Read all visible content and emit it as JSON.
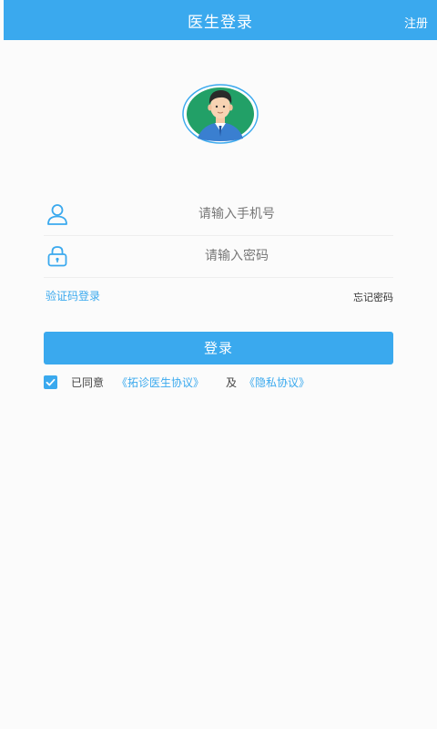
{
  "header": {
    "title": "医生登录",
    "register_label": "注册"
  },
  "avatar": {
    "icon": "doctor-avatar-icon"
  },
  "form": {
    "phone_placeholder": "请输入手机号",
    "phone_value": "",
    "phone_icon": "user-icon",
    "password_placeholder": "请输入密码",
    "password_value": "",
    "password_icon": "lock-icon",
    "sms_login_label": "验证码登录",
    "forgot_password_label": "忘记密码",
    "login_button_label": "登录"
  },
  "agreement": {
    "checked": true,
    "prefix": "已同意",
    "doctor_agreement": "《拓诊医生协议》",
    "and": "及",
    "privacy_agreement": "《隐私协议》"
  },
  "colors": {
    "accent": "#3aa9ee",
    "background": "#fbfbfb"
  }
}
